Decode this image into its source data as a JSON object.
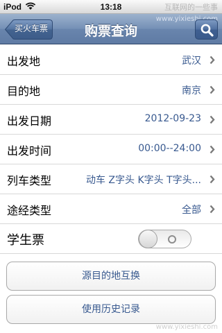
{
  "status_bar": {
    "carrier": "iPod",
    "time": "13:18",
    "watermark": "互联网的一些事"
  },
  "nav_bar": {
    "back_label": "买火车票",
    "title": "购票查询",
    "watermark_url": "www.yixieshi.com",
    "search_icon": "search-icon"
  },
  "form": {
    "rows": [
      {
        "label": "出发地",
        "value": "武汉"
      },
      {
        "label": "目的地",
        "value": "南京"
      },
      {
        "label": "出发日期",
        "value": "2012-09-23"
      },
      {
        "label": "出发时间",
        "value": "00:00--24:00"
      },
      {
        "label": "列车类型",
        "value": "动车 Z字头 K字头 T字头..."
      },
      {
        "label": "途经类型",
        "value": "全部"
      }
    ],
    "student": {
      "label": "学生票",
      "enabled": false
    }
  },
  "buttons": {
    "swap": "源目的地互换",
    "history": "使用历史记录"
  },
  "watermark_bottom": "www.yixieshi.com",
  "colors": {
    "nav_bar": "#6985ad",
    "value_text": "#38598f",
    "search_button": "#3f5f91"
  }
}
